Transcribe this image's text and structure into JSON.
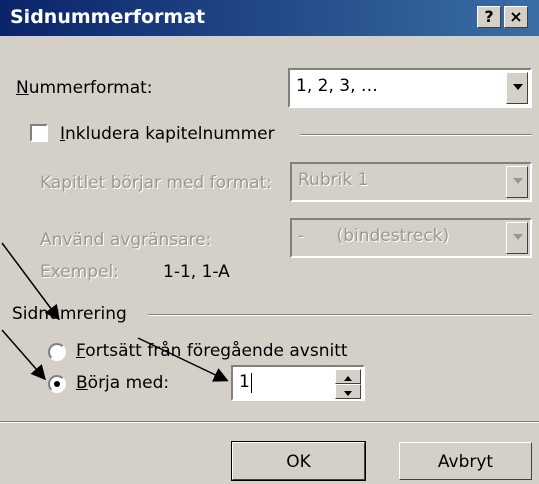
{
  "window": {
    "title": "Sidnummerformat",
    "help_label": "?",
    "close_label": "×"
  },
  "number_format": {
    "label_first": "N",
    "label_rest": "ummerformat:",
    "value": "1, 2, 3, …"
  },
  "include_chapter": {
    "label_first": "I",
    "label_rest": "nkludera kapitelnummer",
    "checked": false
  },
  "chapter_style": {
    "label": "Kapitlet börjar med format:",
    "value": "Rubrik 1"
  },
  "separator": {
    "label": "Använd avgränsare:",
    "value": "-      (bindestreck)"
  },
  "example": {
    "label": "Exempel:",
    "value": "1-1, 1-A"
  },
  "page_numbering": {
    "group_label": "Sidnumrering",
    "continue_first": "F",
    "continue_rest": "ortsätt från föregående avsnitt",
    "start_first": "B",
    "start_rest": "örja med:",
    "start_value": "1",
    "selected": "start"
  },
  "buttons": {
    "ok": "OK",
    "cancel": "Avbryt"
  }
}
